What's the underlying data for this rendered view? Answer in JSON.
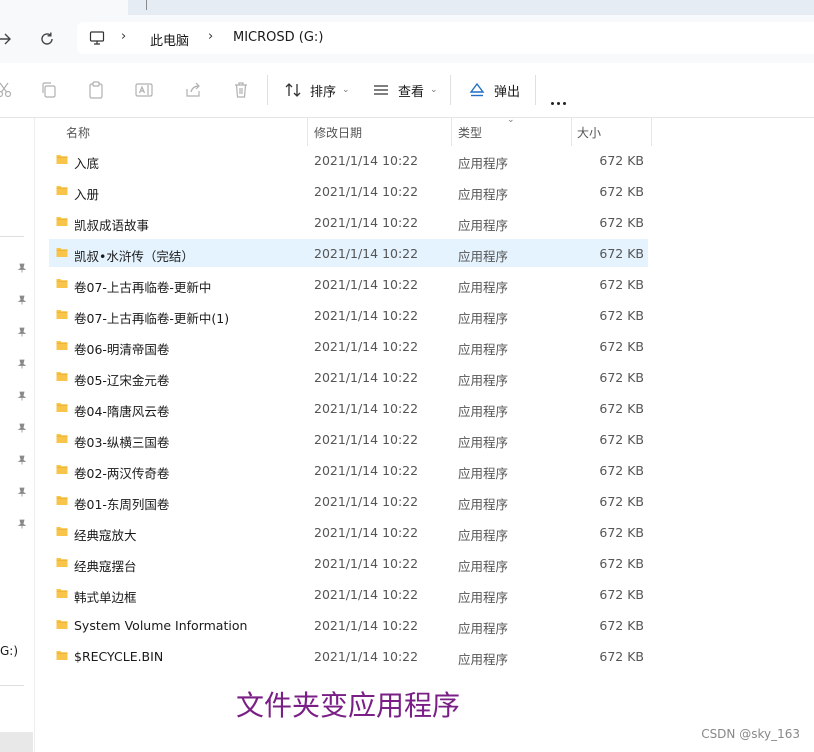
{
  "navigation": {
    "breadcrumbs": [
      "此电脑",
      "MICROSD (G:)"
    ]
  },
  "toolbar": {
    "sort_label": "排序",
    "view_label": "查看",
    "eject_label": "弹出"
  },
  "sidebar": {
    "drive_fragment": "G:)"
  },
  "columns": {
    "name": "名称",
    "date": "修改日期",
    "type": "类型",
    "size": "大小"
  },
  "files": [
    {
      "name": "入底",
      "date": "2021/1/14 10:22",
      "type": "应用程序",
      "size": "672 KB"
    },
    {
      "name": "入册",
      "date": "2021/1/14 10:22",
      "type": "应用程序",
      "size": "672 KB"
    },
    {
      "name": "凯叔成语故事",
      "date": "2021/1/14 10:22",
      "type": "应用程序",
      "size": "672 KB"
    },
    {
      "name": "凯叔•水浒传（完结）",
      "date": "2021/1/14 10:22",
      "type": "应用程序",
      "size": "672 KB",
      "selected": true
    },
    {
      "name": "卷07-上古再临卷-更新中",
      "date": "2021/1/14 10:22",
      "type": "应用程序",
      "size": "672 KB"
    },
    {
      "name": "卷07-上古再临卷-更新中(1)",
      "date": "2021/1/14 10:22",
      "type": "应用程序",
      "size": "672 KB"
    },
    {
      "name": "卷06-明清帝国卷",
      "date": "2021/1/14 10:22",
      "type": "应用程序",
      "size": "672 KB"
    },
    {
      "name": "卷05-辽宋金元卷",
      "date": "2021/1/14 10:22",
      "type": "应用程序",
      "size": "672 KB"
    },
    {
      "name": "卷04-隋唐风云卷",
      "date": "2021/1/14 10:22",
      "type": "应用程序",
      "size": "672 KB"
    },
    {
      "name": "卷03-纵横三国卷",
      "date": "2021/1/14 10:22",
      "type": "应用程序",
      "size": "672 KB"
    },
    {
      "name": "卷02-两汉传奇卷",
      "date": "2021/1/14 10:22",
      "type": "应用程序",
      "size": "672 KB"
    },
    {
      "name": "卷01-东周列国卷",
      "date": "2021/1/14 10:22",
      "type": "应用程序",
      "size": "672 KB"
    },
    {
      "name": "经典寇放大",
      "date": "2021/1/14 10:22",
      "type": "应用程序",
      "size": "672 KB"
    },
    {
      "name": "经典寇摆台",
      "date": "2021/1/14 10:22",
      "type": "应用程序",
      "size": "672 KB"
    },
    {
      "name": "韩式单边框",
      "date": "2021/1/14 10:22",
      "type": "应用程序",
      "size": "672 KB"
    },
    {
      "name": "System Volume Information",
      "date": "2021/1/14 10:22",
      "type": "应用程序",
      "size": "672 KB"
    },
    {
      "name": "$RECYCLE.BIN",
      "date": "2021/1/14 10:22",
      "type": "应用程序",
      "size": "672 KB"
    }
  ],
  "caption": "文件夹变应用程序",
  "watermark": "CSDN @sky_163",
  "colors": {
    "folder": "#f8c54a",
    "selection": "#e5f3fe",
    "caption": "#7a1f86",
    "eject_icon": "#1f6fc5"
  }
}
